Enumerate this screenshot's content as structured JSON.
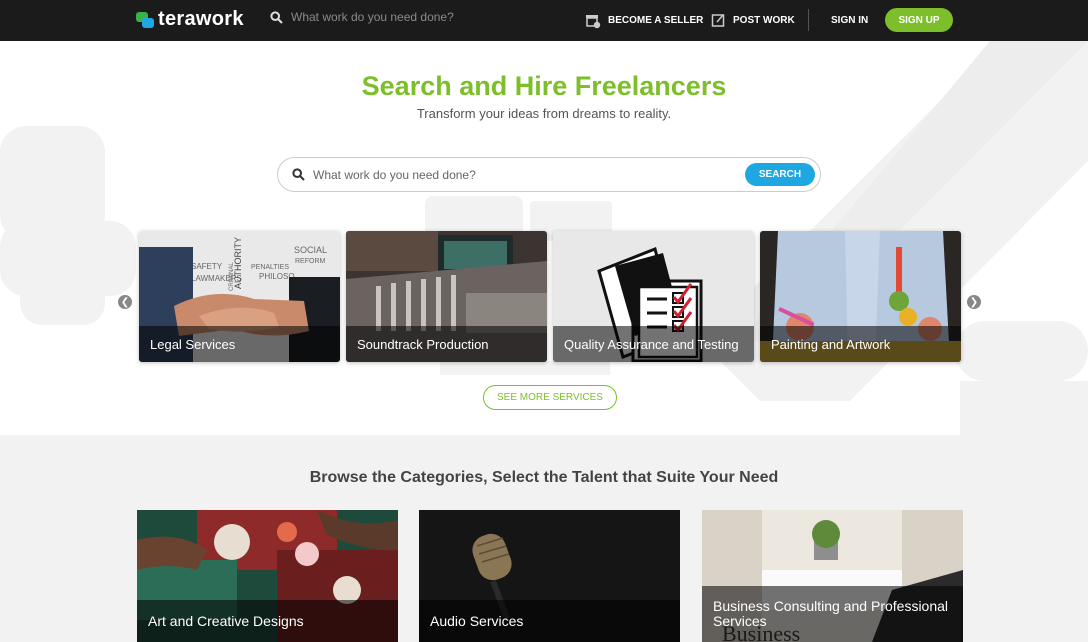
{
  "topbar": {
    "logo_text": "terawork",
    "search_placeholder": "What work do you need done?",
    "become_seller": "BECOME A SELLER",
    "post_work": "POST WORK",
    "sign_in": "SIGN IN",
    "sign_up": "SIGN UP"
  },
  "hero": {
    "title": "Search and Hire Freelancers",
    "subtitle": "Transform your ideas from dreams to reality.",
    "search_placeholder": "What work do you need done?",
    "search_button": "SEARCH",
    "see_more": "SEE MORE SERVICES"
  },
  "services": [
    {
      "label": "Legal Services"
    },
    {
      "label": "Soundtrack Production"
    },
    {
      "label": "Quality Assurance and Testing"
    },
    {
      "label": "Painting and Artwork"
    }
  ],
  "categories": {
    "title": "Browse the Categories, Select the Talent that Suite Your Need",
    "items": [
      {
        "label": "Art and Creative Designs"
      },
      {
        "label": "Audio Services"
      },
      {
        "label": "Business Consulting and Professional Services"
      }
    ]
  },
  "colors": {
    "accent_green": "#7cbf2a",
    "accent_blue": "#1ea7e1",
    "topbar_bg": "#1b1b1b"
  }
}
